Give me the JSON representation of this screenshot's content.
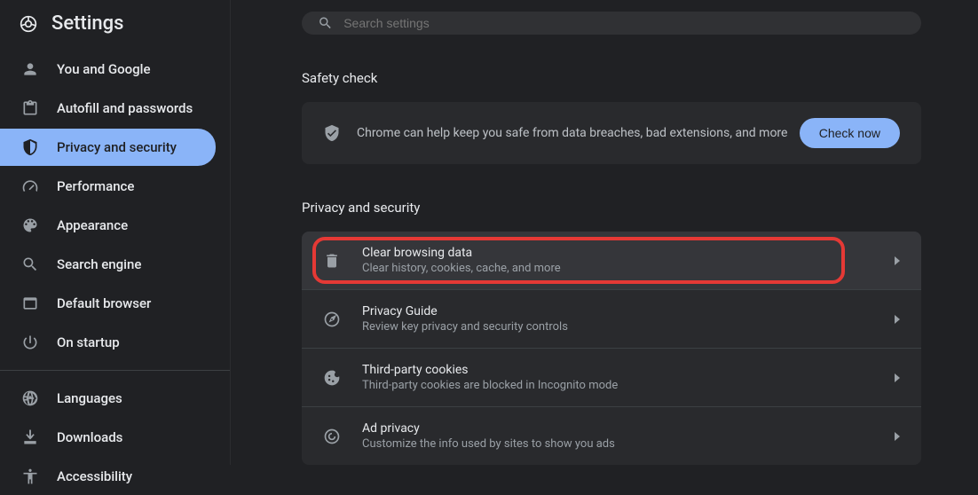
{
  "header": {
    "title": "Settings"
  },
  "search": {
    "placeholder": "Search settings"
  },
  "sidebar": {
    "items": [
      {
        "label": "You and Google"
      },
      {
        "label": "Autofill and passwords"
      },
      {
        "label": "Privacy and security"
      },
      {
        "label": "Performance"
      },
      {
        "label": "Appearance"
      },
      {
        "label": "Search engine"
      },
      {
        "label": "Default browser"
      },
      {
        "label": "On startup"
      }
    ],
    "extra": [
      {
        "label": "Languages"
      },
      {
        "label": "Downloads"
      },
      {
        "label": "Accessibility"
      }
    ]
  },
  "main": {
    "safety": {
      "section": "Safety check",
      "text": "Chrome can help keep you safe from data breaches, bad extensions, and more",
      "button": "Check now"
    },
    "privacy": {
      "section": "Privacy and security",
      "rows": [
        {
          "title": "Clear browsing data",
          "sub": "Clear history, cookies, cache, and more"
        },
        {
          "title": "Privacy Guide",
          "sub": "Review key privacy and security controls"
        },
        {
          "title": "Third-party cookies",
          "sub": "Third-party cookies are blocked in Incognito mode"
        },
        {
          "title": "Ad privacy",
          "sub": "Customize the info used by sites to show you ads"
        }
      ]
    }
  }
}
